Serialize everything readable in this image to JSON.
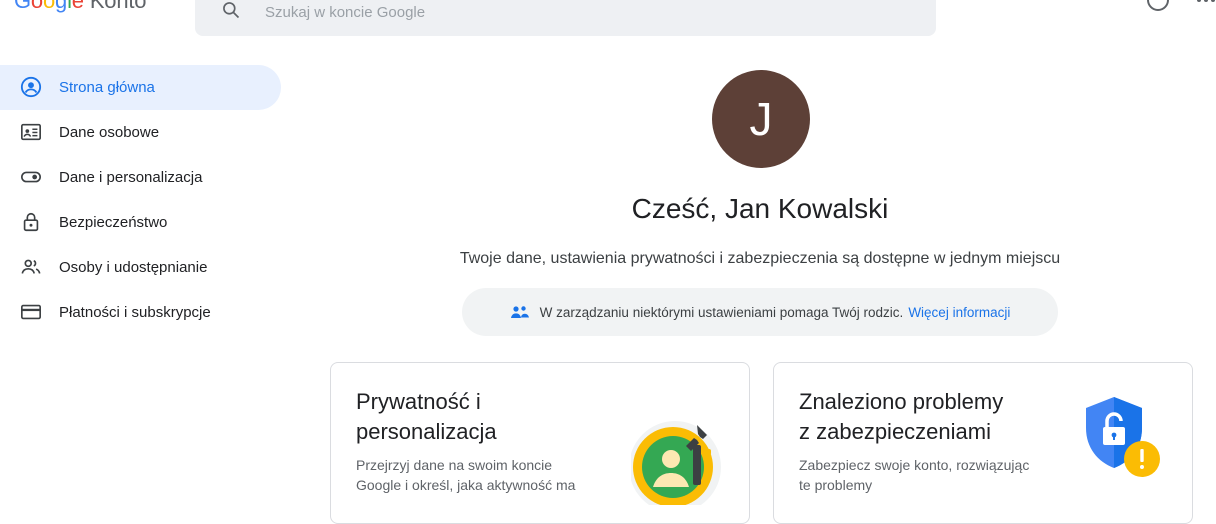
{
  "header": {
    "logo_letters": [
      "G",
      "o",
      "o",
      "g",
      "l",
      "e"
    ],
    "logo_suffix": "Konto",
    "search_placeholder": "Szukaj w koncie Google"
  },
  "sidebar": {
    "items": [
      {
        "label": "Strona główna",
        "icon": "account-circle-icon",
        "active": true
      },
      {
        "label": "Dane osobowe",
        "icon": "id-card-icon",
        "active": false
      },
      {
        "label": "Dane i personalizacja",
        "icon": "toggle-icon",
        "active": false
      },
      {
        "label": "Bezpieczeństwo",
        "icon": "lock-icon",
        "active": false
      },
      {
        "label": "Osoby i udostępnianie",
        "icon": "people-icon",
        "active": false
      },
      {
        "label": "Płatności i subskrypcje",
        "icon": "credit-card-icon",
        "active": false
      }
    ]
  },
  "main": {
    "avatar_letter": "J",
    "avatar_color": "#5d4037",
    "greeting": "Cześć, Jan Kowalski",
    "subtitle": "Twoje dane, ustawienia prywatności i zabezpieczenia są dostępne w jednym miejscu",
    "notice": {
      "text": "W zarządzaniu niektórymi ustawieniami pomaga Twój rodzic.",
      "link": "Więcej informacji",
      "icon": "family-icon"
    },
    "cards": [
      {
        "title_line1": "Prywatność i",
        "title_line2": "personalizacja",
        "text_line1": "Przejrzyj dane na swoim koncie",
        "text_line2": "Google i określ, jaka aktywność ma",
        "illustration": "privacy-illustration-icon"
      },
      {
        "title_line1": "Znaleziono problemy",
        "title_line2": "z zabezpieczeniami",
        "text_line1": "Zabezpiecz swoje konto, rozwiązując",
        "text_line2": "te problemy",
        "illustration": "security-shield-warning-icon"
      }
    ]
  },
  "colors": {
    "accent": "#1a73e8",
    "active_bg": "#e8f0fe",
    "shield_blue": "#1a73e8",
    "warning": "#f9ab00"
  }
}
